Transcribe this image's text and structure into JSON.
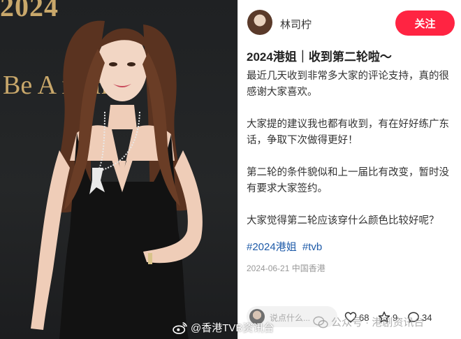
{
  "photo": {
    "backdrop_year": "2024",
    "backdrop_slogan": "Be A     man —"
  },
  "post": {
    "author": {
      "name": "林司柠"
    },
    "follow_label": "关注",
    "title": "2024港姐｜收到第二轮啦～",
    "body": [
      "最近几天收到非常多大家的评论支持，真的很感谢大家喜欢。",
      "大家提的建议我也都有收到，有在好好练广东话，争取下次做得更好！",
      "第二轮的条件貌似和上一届比有改变，暂时没有要求大家签约。",
      "大家觉得第二轮应该穿什么颜色比较好呢？"
    ],
    "tags": [
      "#2024港姐",
      "#tvb"
    ],
    "date": "2024-06-21",
    "location": "中国香港",
    "comment_placeholder": "说点什么...",
    "likes": "68",
    "favorites": "9",
    "comments": "34"
  },
  "watermarks": {
    "weibo": "@香港TVB资讯台",
    "wechat": "公众号 · 港剧资讯台"
  },
  "colors": {
    "accent": "#ff2442",
    "tag": "#1d5aa8",
    "backdrop_gold": "#c9a86b"
  },
  "icons": [
    "heart-icon",
    "star-icon",
    "comment-icon",
    "weibo-logo-icon",
    "wechat-icon"
  ]
}
